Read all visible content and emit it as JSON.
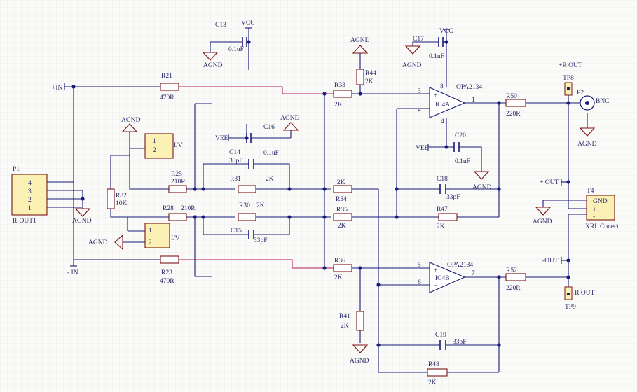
{
  "theme": {
    "grid": "#e6e6e6",
    "wire": "#1a1a7a",
    "wire_highlight": "#b3205a",
    "body_fill": "#fcf1b4",
    "outline": "#7a1414",
    "text": "#2a2a6a"
  },
  "components": {
    "P1": {
      "ref": "P1",
      "name": "R-OUT1",
      "pins": [
        "4",
        "3",
        "2",
        "1"
      ]
    },
    "R82": {
      "ref": "R82",
      "value": "10K"
    },
    "IV1": {
      "pins": [
        "1",
        "2"
      ],
      "label": "I/V"
    },
    "IV2": {
      "pins": [
        "1",
        "2"
      ],
      "label": "I/V"
    },
    "R21": {
      "ref": "R21",
      "value": "470R"
    },
    "R23": {
      "ref": "R23",
      "value": "470R"
    },
    "R25": {
      "ref": "R25",
      "value": "210R"
    },
    "R28": {
      "ref": "R28",
      "value": "210R"
    },
    "R30": {
      "ref": "R30",
      "value": "2K"
    },
    "R31": {
      "ref": "R31",
      "value": "2K"
    },
    "C14": {
      "ref": "C14",
      "value": "33pF"
    },
    "C15": {
      "ref": "C15",
      "value": "33pF"
    },
    "C16": {
      "ref": "C16",
      "value": "0.1uF"
    },
    "C13": {
      "ref": "C13",
      "value": "0.1uF"
    },
    "R33": {
      "ref": "R33",
      "value": "2K"
    },
    "R34": {
      "ref": "R34",
      "value": "2K"
    },
    "R35": {
      "ref": "R35",
      "value": "2K"
    },
    "R36": {
      "ref": "R36",
      "value": "2K"
    },
    "R44": {
      "ref": "R44",
      "value": "2K"
    },
    "R41": {
      "ref": "R41",
      "value": "2K"
    },
    "C17": {
      "ref": "C17",
      "value": "0.1uF"
    },
    "C20": {
      "ref": "C20",
      "value": "0.1uF"
    },
    "C18": {
      "ref": "C18",
      "value": "33pF"
    },
    "C19": {
      "ref": "C19",
      "value": "33pF"
    },
    "R47": {
      "ref": "R47",
      "value": "2K"
    },
    "R48": {
      "ref": "R48",
      "value": "2K"
    },
    "R50": {
      "ref": "R50",
      "value": "220R"
    },
    "R52": {
      "ref": "R52",
      "value": "220R"
    },
    "IC4A": {
      "ref": "IC4A",
      "part": "OPA2134",
      "pin_plus": "3",
      "pin_minus": "2",
      "pin_out": "1",
      "pin_vplus": "8",
      "pin_vminus": "4",
      "sign_plus": "+",
      "sign_minus": "−"
    },
    "IC4B": {
      "ref": "IC4B",
      "part": "OPA2134",
      "pin_plus": "5",
      "pin_minus": "6",
      "pin_out": "7",
      "sign_plus": "+",
      "sign_minus": "−"
    },
    "P2": {
      "ref": "P2",
      "name": "BNC"
    },
    "T4": {
      "ref": "T4",
      "name": "XRL Conect",
      "pins": [
        "GND",
        "+",
        "-"
      ]
    },
    "TP8": {
      "ref": "TP8"
    },
    "TP9": {
      "ref": "TP9"
    }
  },
  "nets": {
    "plus_in": "+IN",
    "minus_in": "- IN",
    "agnd": "AGND",
    "vcc": "VCC",
    "vee": "VEE",
    "plus_r_out": "+R OUT",
    "minus_r_out": "-R OUT",
    "plus_out": "+ OUT",
    "minus_out": "-OUT"
  }
}
